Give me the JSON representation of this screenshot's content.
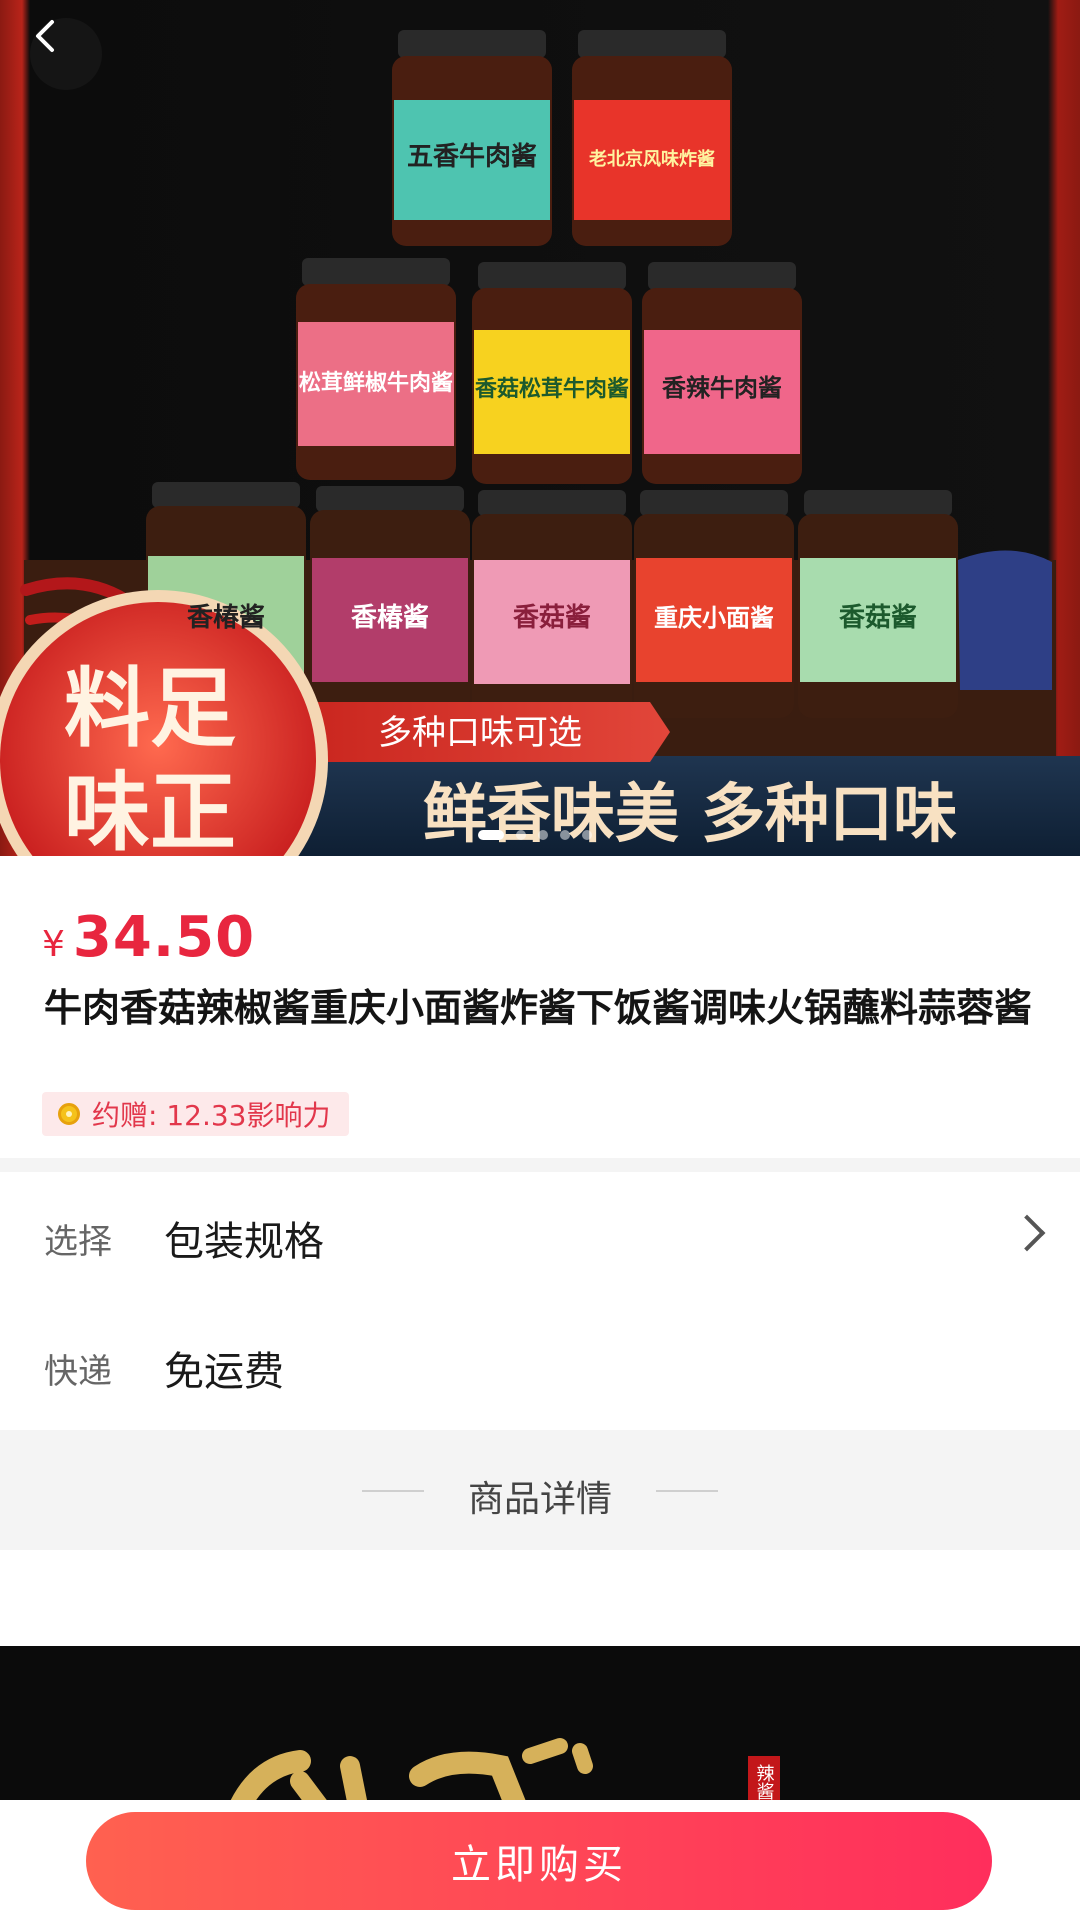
{
  "product": {
    "currency_symbol": "¥",
    "price": "34.50",
    "title": "牛肉香菇辣椒酱重庆小面酱炸酱下饭酱调味火锅蘸料蒜蓉酱",
    "reward_text": "约赠: 12.33影响力"
  },
  "banner": {
    "badge_line1": "料足",
    "badge_line2": "味正",
    "ribbon_text": "多种口味可选",
    "slogan": "鲜香味美 多种口味",
    "jar_labels": [
      "五香牛肉酱",
      "老北京风味炸酱",
      "松茸鲜椒牛肉酱",
      "香菇松茸牛肉酱",
      "香辣牛肉酱",
      "香椿酱",
      "香椿酱",
      "香菇酱",
      "重庆小面酱",
      "香菇酱"
    ],
    "dots_count": 5,
    "active_dot": 0
  },
  "options": {
    "select_label": "选择",
    "select_value": "包装规格",
    "shipping_label": "快递",
    "shipping_value": "免运费"
  },
  "detail": {
    "section_title": "商品详情",
    "banner_partial_text": "辣酱"
  },
  "actions": {
    "buy_label": "立即购买"
  },
  "colors": {
    "accent": "#e8263f",
    "button_start": "#ff6150",
    "button_end": "#ff2e5c",
    "reward_bg": "#fde9ea"
  }
}
